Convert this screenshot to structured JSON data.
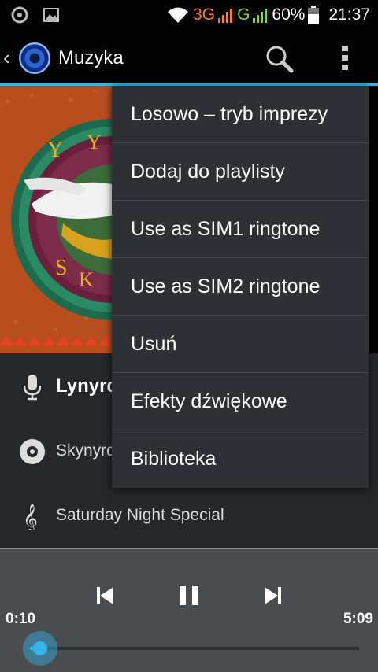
{
  "status_bar": {
    "network_3g": "3G",
    "network_g": "G",
    "battery": "60%",
    "time": "21:37",
    "icons": [
      "settings-notification-icon",
      "image-notification-icon",
      "wifi-icon",
      "signal-icon",
      "battery-icon"
    ]
  },
  "action_bar": {
    "title": "Muzyka",
    "icons": [
      "back-chevron-icon",
      "music-app-icon",
      "search-icon",
      "overflow-menu-icon"
    ]
  },
  "track": {
    "artist": "Lynyrd Skynyrd",
    "album": "Skynyrd's Innyrds",
    "song": "Saturday Night Special"
  },
  "player": {
    "elapsed": "0:10",
    "duration": "5:09",
    "progress_fraction": 0.032
  },
  "menu": {
    "items": [
      "Losowo – tryb imprezy",
      "Dodaj do playlisty",
      "Use as SIM1 ringtone",
      "Use as SIM2 ringtone",
      "Usuń",
      "Efekty dźwiękowe",
      "Biblioteka"
    ]
  },
  "colors": {
    "accent": "#33b5e5",
    "network_3g": "#ff7f27",
    "network_g": "#8cd236",
    "menu_bg": "#2e3035",
    "info_bg": "#25272b",
    "player_bg": "#4a4c50"
  }
}
